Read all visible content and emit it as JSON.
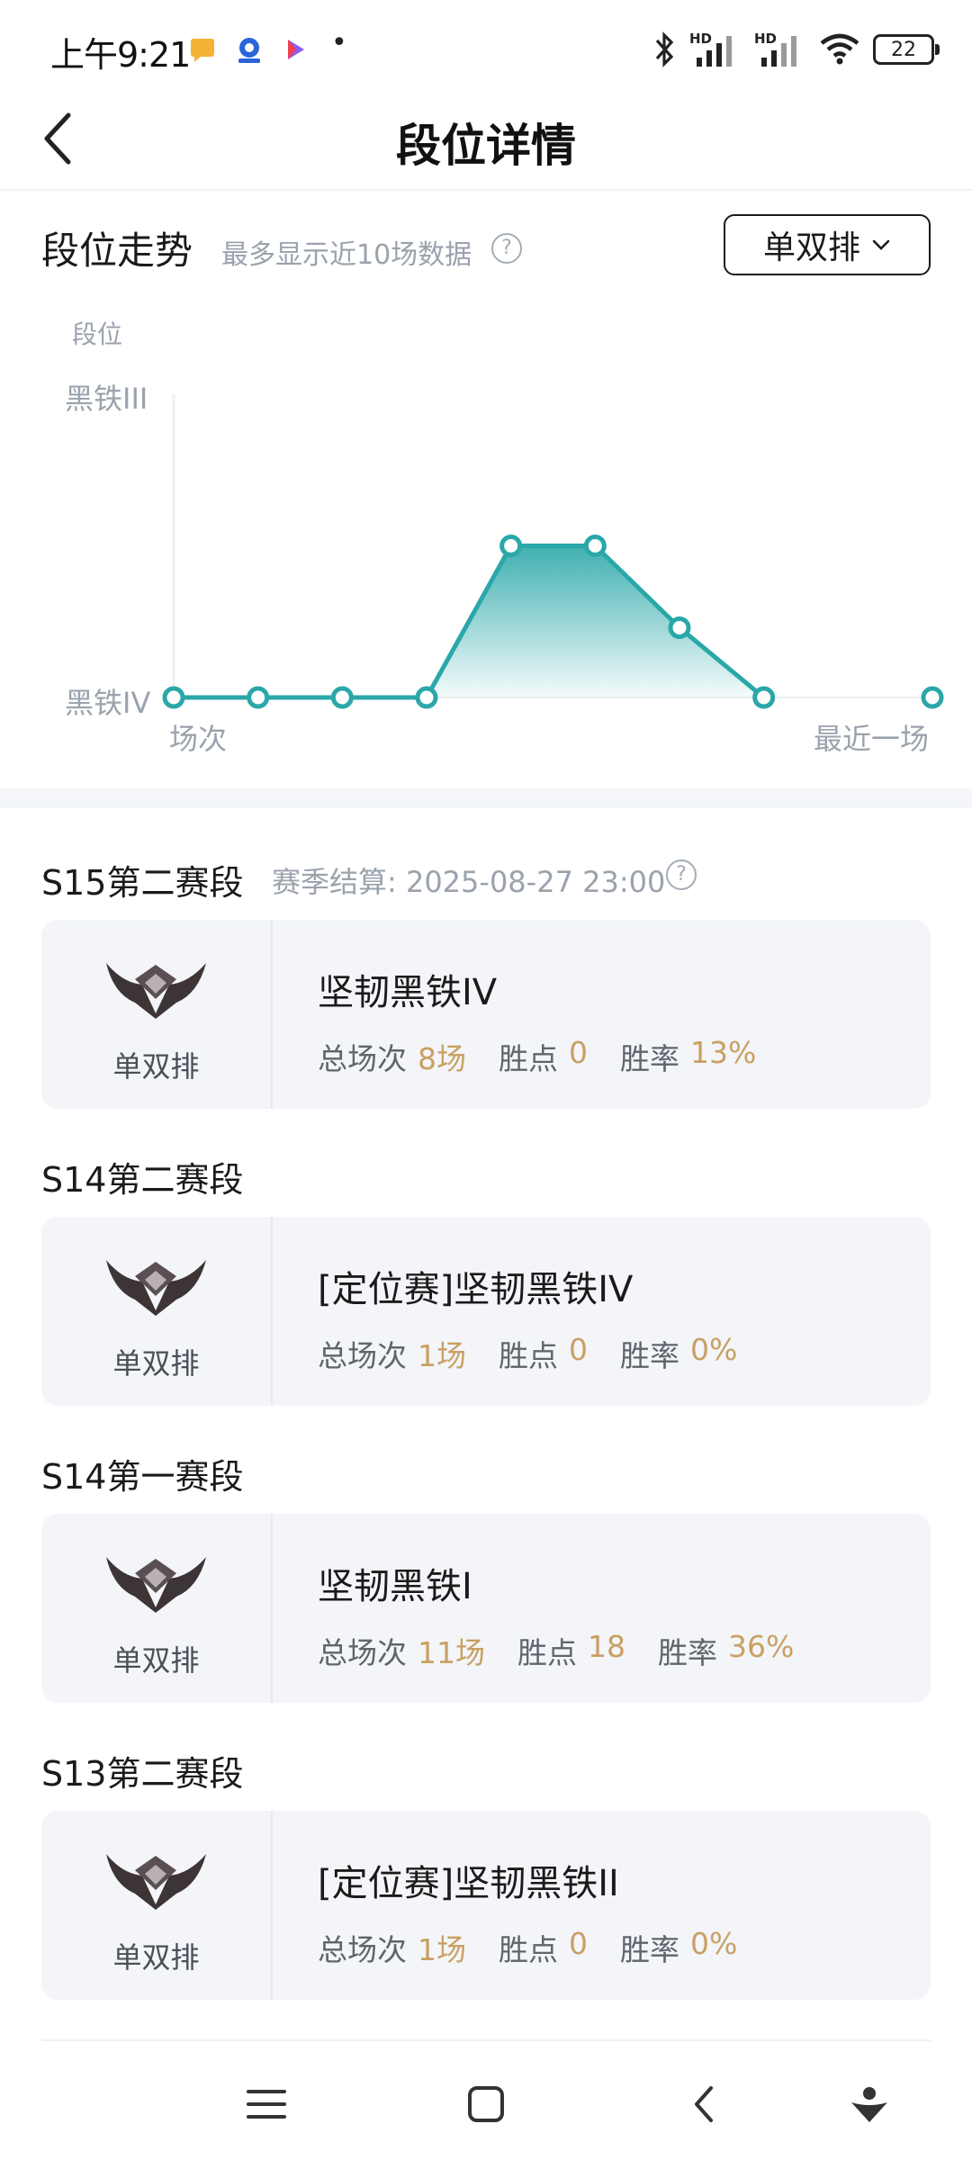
{
  "status_bar": {
    "time": "上午9:21",
    "battery": "22",
    "network_labels": [
      "HD",
      "HD"
    ],
    "dot": "•"
  },
  "header": {
    "title": "段位详情"
  },
  "trend": {
    "title": "段位走势",
    "hint": "最多显示近10场数据",
    "help_glyph": "?",
    "queue_select": "单双排"
  },
  "chart_data": {
    "type": "area",
    "ylabel": "段位",
    "y_ticks": [
      "黑铁III",
      "黑铁IV"
    ],
    "x_start_label": "场次",
    "x_end_label": "最近一场",
    "series": [
      {
        "values": [
          0,
          0,
          0,
          0,
          0.5,
          0.5,
          0.23,
          0,
          null,
          0
        ]
      }
    ],
    "note_scale": "0 = 黑铁IV, 1 = 黑铁III",
    "color": "#2aa7a9"
  },
  "seasons": [
    {
      "title": "S15第二赛段",
      "settlement": "赛季结算: 2025-08-27 23:00",
      "queue": "单双排",
      "rank": "坚韧黑铁IV",
      "games_label": "总场次",
      "games": "8场",
      "lp_label": "胜点",
      "lp": "0",
      "winrate_label": "胜率",
      "winrate": "13%"
    },
    {
      "title": "S14第二赛段",
      "queue": "单双排",
      "rank": "[定位赛]坚韧黑铁IV",
      "games_label": "总场次",
      "games": "1场",
      "lp_label": "胜点",
      "lp": "0",
      "winrate_label": "胜率",
      "winrate": "0%"
    },
    {
      "title": "S14第一赛段",
      "queue": "单双排",
      "rank": "坚韧黑铁I",
      "games_label": "总场次",
      "games": "11场",
      "lp_label": "胜点",
      "lp": "18",
      "winrate_label": "胜率",
      "winrate": "36%"
    },
    {
      "title": "S13第二赛段",
      "queue": "单双排",
      "rank": "[定位赛]坚韧黑铁II",
      "games_label": "总场次",
      "games": "1场",
      "lp_label": "胜点",
      "lp": "0",
      "winrate_label": "胜率",
      "winrate": "0%"
    }
  ],
  "colors": {
    "accent_teal": "#2aa7a9",
    "stat_gold": "#c9a063",
    "muted_text": "#9aa2ad",
    "card_bg": "#f3f5f9"
  }
}
